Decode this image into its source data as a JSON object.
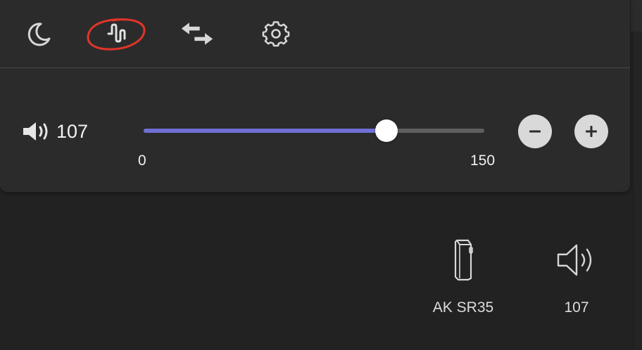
{
  "toolbar": {
    "buttons": [
      {
        "icon": "moon-icon"
      },
      {
        "icon": "waveform-icon",
        "highlight": "red-circle"
      },
      {
        "icon": "swap-arrows-icon"
      },
      {
        "icon": "gear-icon"
      }
    ]
  },
  "volume": {
    "value": "107",
    "min_label": "0",
    "max_label": "150",
    "level_fraction": 0.7133,
    "decrease_icon": "minus-icon",
    "increase_icon": "plus-icon"
  },
  "devices": [
    {
      "label": "AK SR35",
      "icon": "portable-player-icon"
    },
    {
      "label": "107",
      "icon": "speaker-icon"
    }
  ],
  "colors": {
    "background": "#222222",
    "panel": "#2b2b2b",
    "accent": "#6f6fd6",
    "highlight": "#e0352b"
  }
}
